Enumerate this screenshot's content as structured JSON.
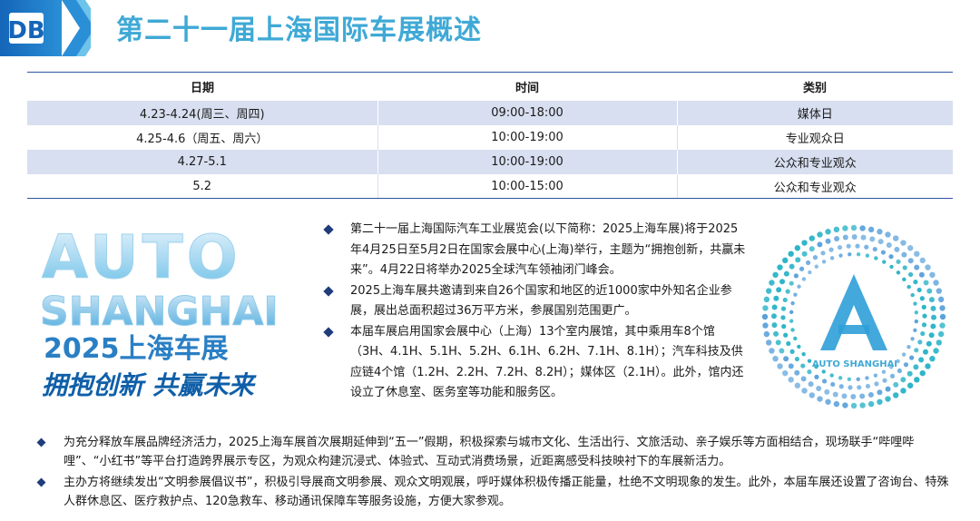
{
  "header": {
    "logo_text": "DB",
    "title": "第二十一届上海国际车展概述"
  },
  "schedule": {
    "headers": [
      "日期",
      "时间",
      "类别"
    ],
    "rows": [
      {
        "date": "4.23-4.24(周三、周四)",
        "time": "09:00-18:00",
        "type": "媒体日"
      },
      {
        "date": "4.25-4.6（周五、周六）",
        "time": "10:00-19:00",
        "type": "专业观众日"
      },
      {
        "date": "4.27-5.1",
        "time": "10:00-19:00",
        "type": "公众和专业观众"
      },
      {
        "date": "5.2",
        "time": "10:00-15:00",
        "type": "公众和专业观众"
      }
    ]
  },
  "brand_art": {
    "line1": "AUTO",
    "line2": "SHANGHAI",
    "line3": "2025上海车展",
    "slogan": "拥抱创新  共赢未来"
  },
  "ring_logo": {
    "caption": "AUTO SHANGHAI"
  },
  "mid_bullets": [
    "第二十一届上海国际汽车工业展览会(以下简称：2025上海车展)将于2025年4月25日至5月2日在国家会展中心(上海)举行，主题为“拥抱创新，共赢未来”。4月22日将举办2025全球汽车领袖闭门峰会。",
    "2025上海车展共邀请到来自26个国家和地区的近1000家中外知名企业参展，展出总面积超过36万平方米，参展国别范围更广。",
    "本届车展启用国家会展中心（上海）13个室内展馆，其中乘用车8个馆（3H、4.1H、5.1H、5.2H、6.1H、6.2H、7.1H、8.1H）；汽车科技及供应链4个馆（1.2H、2.2H、7.2H、8.2H）；媒体区（2.1H）。此外，馆内还设立了休息室、医务室等功能和服务区。"
  ],
  "bottom_bullets": [
    "为充分释放车展品牌经济活力，2025上海车展首次展期延伸到“五一”假期，积极探索与城市文化、生活出行、文旅活动、亲子娱乐等方面相结合，现场联手“哔哩哔哩”、“小红书”等平台打造跨界展示专区，为观众构建沉浸式、体验式、互动式消费场景，近距离感受科技映衬下的车展新活力。",
    "主办方将继续发出“文明参展倡议书”，积极引导展商文明参展、观众文明观展，呼吁媒体积极传播正能量，杜绝不文明现象的发生。此外，本届车展还设置了咨询台、特殊人群休息区、医疗救护点、120急救车、移动通讯保障车等服务设施，方便大家参观。"
  ],
  "colors": {
    "header_blue": "#1a6fc0",
    "header_cyan": "#3fa9d6",
    "table_shade": "#d8dff0",
    "bullet_navy": "#1f3d7a"
  }
}
